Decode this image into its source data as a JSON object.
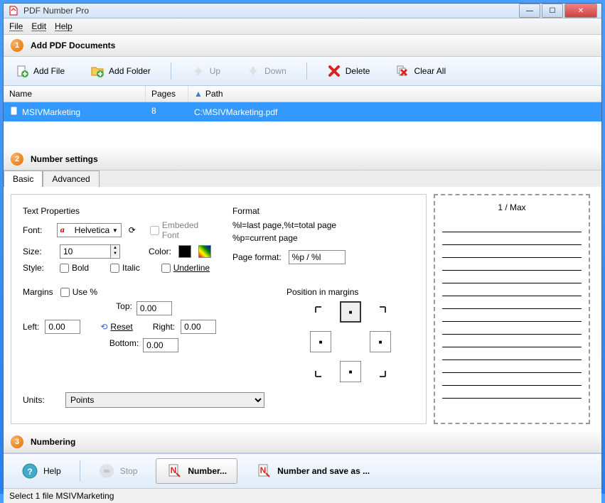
{
  "window": {
    "title": "PDF Number Pro"
  },
  "menu": {
    "file": "File",
    "edit": "Edit",
    "help": "Help"
  },
  "section1": {
    "title": "Add PDF Documents"
  },
  "toolbar": {
    "add_file": "Add File",
    "add_folder": "Add Folder",
    "up": "Up",
    "down": "Down",
    "delete": "Delete",
    "clear_all": "Clear All"
  },
  "columns": {
    "name": "Name",
    "pages": "Pages",
    "path": "Path"
  },
  "rows": [
    {
      "name": "MSIVMarketing",
      "pages": "8",
      "path": "C:\\MSIVMarketing.pdf"
    }
  ],
  "section2": {
    "title": "Number settings"
  },
  "tabs": {
    "basic": "Basic",
    "advanced": "Advanced"
  },
  "text_props": {
    "legend": "Text Properties",
    "font_lbl": "Font:",
    "font_val": "Helvetica",
    "embed": "Embeded Font",
    "size_lbl": "Size:",
    "size_val": "10",
    "color_lbl": "Color:",
    "style_lbl": "Style:",
    "bold": "Bold",
    "italic": "Italic",
    "underline": "Underline"
  },
  "margins": {
    "legend": "Margins",
    "use_pct": "Use %",
    "top": "Top:",
    "top_v": "0.00",
    "left": "Left:",
    "left_v": "0.00",
    "right": "Right:",
    "right_v": "0.00",
    "bottom": "Bottom:",
    "bottom_v": "0.00",
    "reset": "Reset"
  },
  "units": {
    "lbl": "Units:",
    "val": "Points"
  },
  "format": {
    "legend": "Format",
    "hint1": "%l=last page,%t=total page",
    "hint2": "%p=current page",
    "pf_lbl": "Page format:",
    "pf_val": "%p / %l"
  },
  "position": {
    "legend": "Position in margins"
  },
  "preview": {
    "title": "1 / Max"
  },
  "section3": {
    "title": "Numbering"
  },
  "bottom": {
    "help": "Help",
    "stop": "Stop",
    "number": "Number...",
    "number_save": "Number and save as ..."
  },
  "status": "Select 1 file MSIVMarketing"
}
